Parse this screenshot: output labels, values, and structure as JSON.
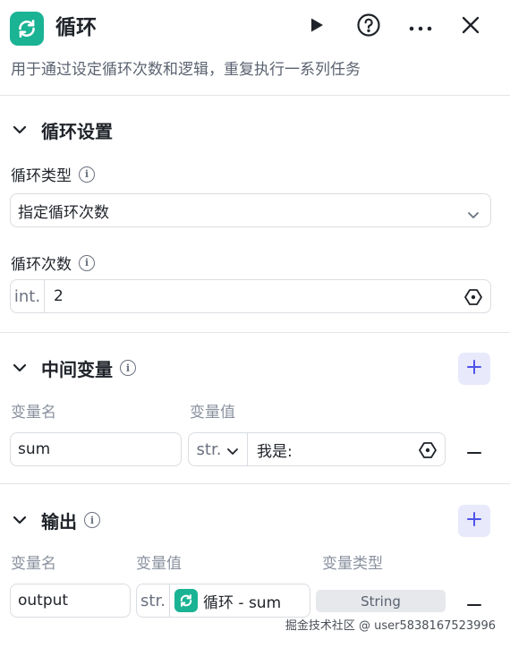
{
  "header": {
    "title": "循环",
    "icons": {
      "app": "loop-icon",
      "run": "play-icon",
      "help": "help-icon",
      "more": "more-icon",
      "close": "close-icon"
    }
  },
  "description": "用于通过设定循环次数和逻辑，重复执行一系列任务",
  "loop_settings": {
    "title": "循环设置",
    "loop_type_label": "循环类型",
    "loop_type_value": "指定循环次数",
    "loop_count_label": "循环次数",
    "loop_count_type": "int.",
    "loop_count_value": "2"
  },
  "intermediate_vars": {
    "title": "中间变量",
    "col_name": "变量名",
    "col_value": "变量值",
    "rows": [
      {
        "name": "sum",
        "type": "str.",
        "value": "我是:"
      }
    ]
  },
  "output": {
    "title": "输出",
    "col_name": "变量名",
    "col_value": "变量值",
    "col_type": "变量类型",
    "rows": [
      {
        "name": "output",
        "type": "str.",
        "ref": "循环 - sum",
        "var_type": "String"
      }
    ]
  },
  "watermark": "掘金技术社区 @ user5838167523996",
  "colors": {
    "accent": "#1ab394",
    "add_button_bg": "#e8e9fb",
    "add_button_icon": "#4d53e8"
  }
}
